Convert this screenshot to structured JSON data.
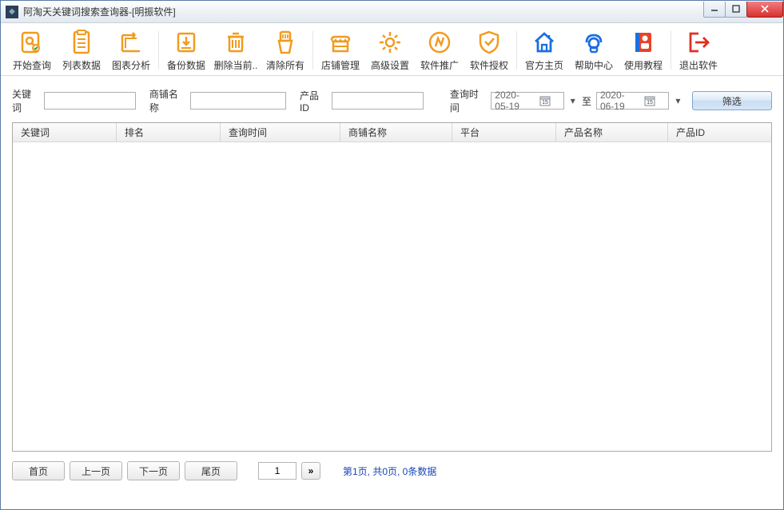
{
  "window": {
    "title": "阿淘天关键词搜索查询器-[明振软件]"
  },
  "toolbar": [
    {
      "label": "开始查询",
      "color": "#f29b1f",
      "name": "start-query",
      "sep": false
    },
    {
      "label": "列表数据",
      "color": "#f29b1f",
      "name": "list-data",
      "sep": false
    },
    {
      "label": "图表分析",
      "color": "#f29b1f",
      "name": "chart-analysis",
      "sep": true
    },
    {
      "label": "备份数据",
      "color": "#f29b1f",
      "name": "backup-data",
      "sep": false
    },
    {
      "label": "删除当前..",
      "color": "#f29b1f",
      "name": "delete-current",
      "sep": false
    },
    {
      "label": "清除所有",
      "color": "#f29b1f",
      "name": "clear-all",
      "sep": true
    },
    {
      "label": "店铺管理",
      "color": "#f29b1f",
      "name": "shop-manage",
      "sep": false
    },
    {
      "label": "高级设置",
      "color": "#f29b1f",
      "name": "adv-settings",
      "sep": false
    },
    {
      "label": "软件推广",
      "color": "#f29b1f",
      "name": "promote",
      "sep": false
    },
    {
      "label": "软件授权",
      "color": "#f29b1f",
      "name": "license",
      "sep": true
    },
    {
      "label": "官方主页",
      "color": "#1b6fe0",
      "name": "homepage",
      "sep": false
    },
    {
      "label": "帮助中心",
      "color": "#1b6fe0",
      "name": "help",
      "sep": false
    },
    {
      "label": "使用教程",
      "color": "#1b6fe0",
      "name": "tutorial",
      "sep": true
    },
    {
      "label": "退出软件",
      "color": "#e02f1f",
      "name": "exit",
      "sep": false
    }
  ],
  "filter": {
    "keyword_label": "关键词",
    "keyword_value": "",
    "shop_label": "商铺名称",
    "shop_value": "",
    "pid_label": "产品ID",
    "pid_value": "",
    "time_label": "查询时间",
    "date_from": "2020-05-19",
    "to_label": "至",
    "date_to": "2020-06-19",
    "submit_label": "筛选"
  },
  "table": {
    "columns": [
      {
        "label": "关键词",
        "w": 130
      },
      {
        "label": "排名",
        "w": 130
      },
      {
        "label": "查询时间",
        "w": 150
      },
      {
        "label": "商铺名称",
        "w": 140
      },
      {
        "label": "平台",
        "w": 130
      },
      {
        "label": "产品名称",
        "w": 140
      },
      {
        "label": "产品ID",
        "w": 0
      }
    ],
    "rows": []
  },
  "pager": {
    "first": "首页",
    "prev": "上一页",
    "next": "下一页",
    "last": "尾页",
    "page_value": "1",
    "go": "»",
    "info": "第1页, 共0页, 0条数据"
  }
}
